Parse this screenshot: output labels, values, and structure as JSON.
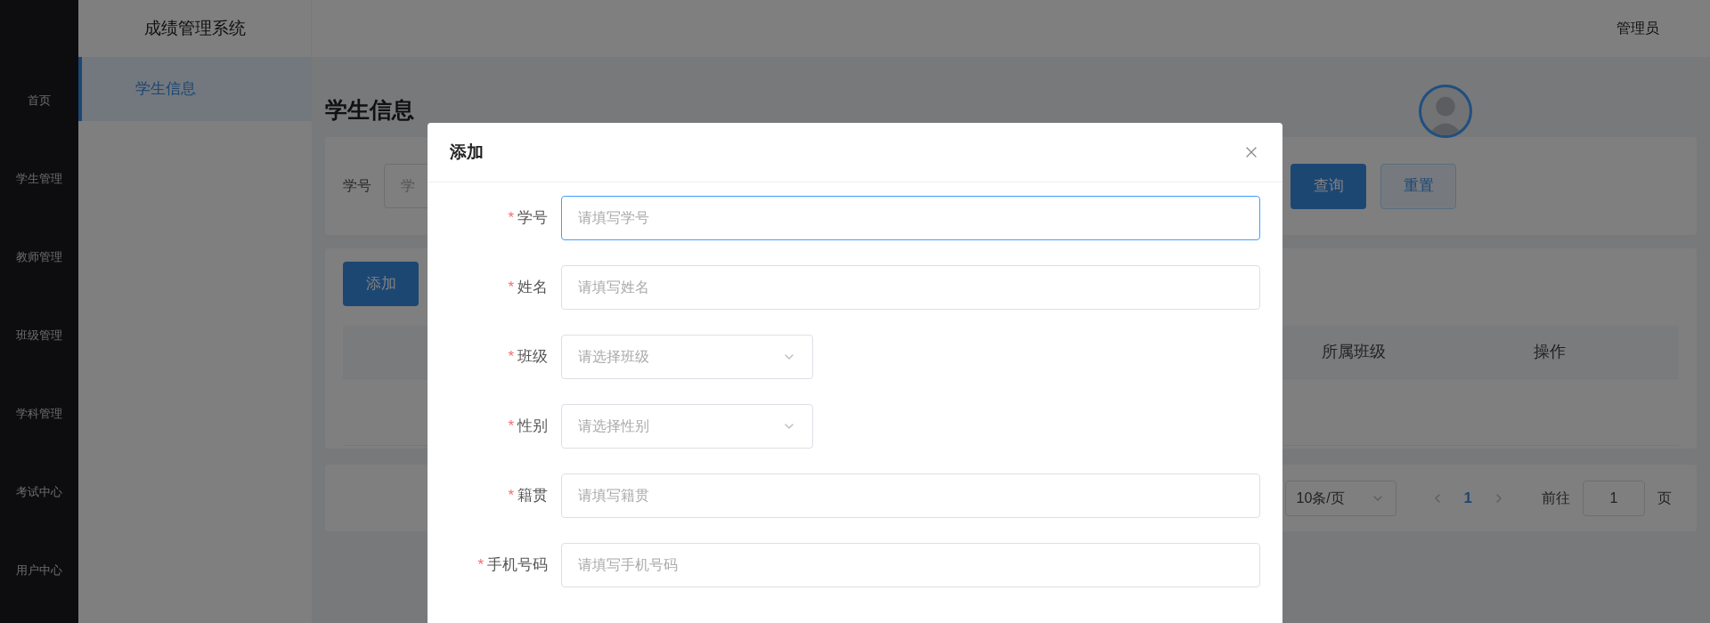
{
  "sidebar": {
    "items": [
      {
        "label": "首页"
      },
      {
        "label": "学生管理"
      },
      {
        "label": "教师管理"
      },
      {
        "label": "班级管理"
      },
      {
        "label": "学科管理"
      },
      {
        "label": "考试中心"
      },
      {
        "label": "用户中心"
      }
    ]
  },
  "header": {
    "title": "成绩管理系统",
    "user": "管理员"
  },
  "submenu": {
    "items": [
      {
        "label": "学生信息",
        "selected": true
      }
    ]
  },
  "page": {
    "title": "学生信息",
    "search": {
      "label": "学号",
      "placeholder": "学",
      "buttons": [
        {
          "label": "查询",
          "kind": "primary"
        },
        {
          "label": "重置",
          "kind": "plain"
        }
      ]
    },
    "add_button": "添加",
    "table": {
      "columns": [
        "所属班级",
        "操作"
      ]
    },
    "pagination": {
      "page_size": "10条/页",
      "pages": [
        {
          "label": "1",
          "selected": true
        }
      ],
      "goto_label": "前往",
      "goto_value": "1",
      "goto_suffix": "页"
    }
  },
  "dialog": {
    "title": "添加",
    "required_mark": "*",
    "fields": [
      {
        "label": "学号",
        "kind": "input",
        "placeholder": "请填写学号",
        "required": true,
        "focused": true
      },
      {
        "label": "姓名",
        "kind": "input",
        "placeholder": "请填写姓名",
        "required": true,
        "focused": false
      },
      {
        "label": "班级",
        "kind": "select",
        "placeholder": "请选择班级",
        "required": true,
        "focused": false
      },
      {
        "label": "性别",
        "kind": "select",
        "placeholder": "请选择性别",
        "required": true,
        "focused": false
      },
      {
        "label": "籍贯",
        "kind": "input",
        "placeholder": "请填写籍贯",
        "required": true,
        "focused": false
      },
      {
        "label": "手机号码",
        "kind": "input",
        "placeholder": "请填写手机号码",
        "required": true,
        "focused": false
      }
    ]
  }
}
